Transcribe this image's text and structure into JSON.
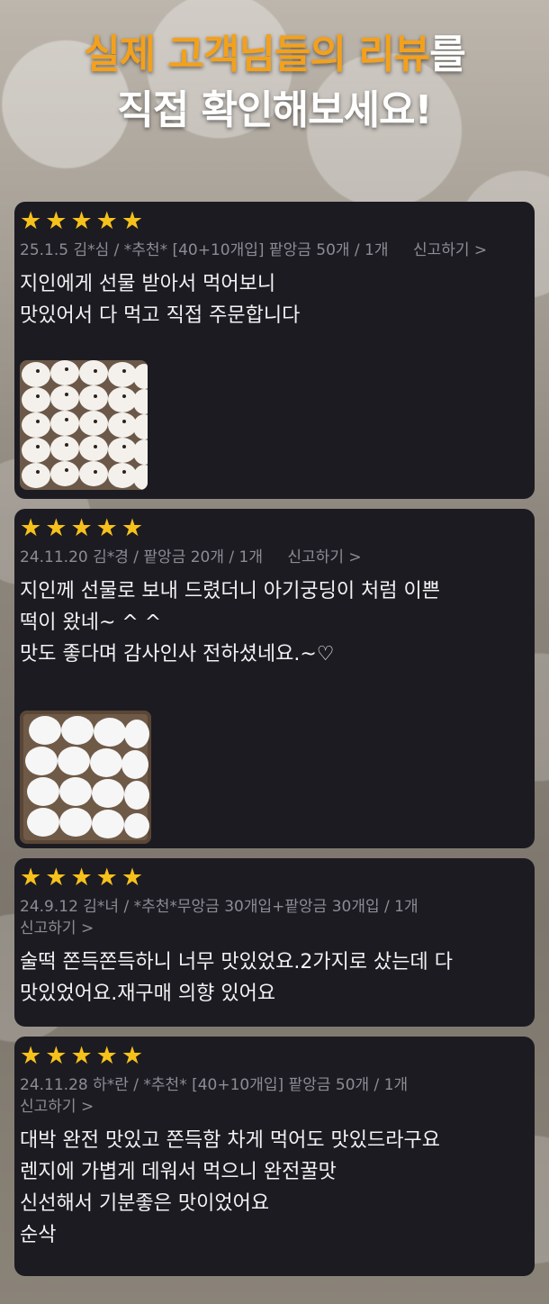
{
  "header": {
    "line1_orange": "실제 고객님들의 리뷰",
    "line1_white": "를",
    "line2": "직접 확인해보세요!"
  },
  "colors": {
    "accent": "#f3a11c",
    "star": "#f7c11b",
    "card_bg": "#1c1b22"
  },
  "reviews": [
    {
      "rating": 5,
      "meta": "25.1.5 김*심 / *추천* [40+10개입] 팥앙금 50개 / 1개",
      "report": "신고하기 >",
      "text_lines": [
        "지인에게 선물 받아서 먹어보니",
        "맛있어서 다 먹고 직접 주문합니다"
      ],
      "photo_icon": "rice-cake-photo"
    },
    {
      "rating": 5,
      "meta": "24.11.20 김*경 / 팥앙금 20개 / 1개",
      "report": "신고하기 >",
      "text_lines": [
        "지인께 선물로 보내 드렸더니 아기궁딩이 처럼 이쁜",
        "떡이 왔네~ ^ ^",
        "맛도 좋다며 감사인사 전하셨네요.~♡"
      ],
      "photo_icon": "rice-cake-photo"
    },
    {
      "rating": 5,
      "meta": "24.9.12 김*녀 / *추천*무앙금 30개입+팥앙금 30개입 / 1개",
      "report": "신고하기 >",
      "text_lines": [
        "술떡 쫀득쫀득하니 너무 맛있었요.2가지로 샀는데 다",
        "맛있었어요.재구매 의향 있어요"
      ]
    },
    {
      "rating": 5,
      "meta": "24.11.28 하*란 / *추천* [40+10개입] 팥앙금 50개 / 1개",
      "report": "신고하기 >",
      "text_lines": [
        "대박 완전 맛있고 쫀득함 차게 먹어도 맛있드라구요",
        "렌지에 가볍게 데워서 먹으니 완전꿀맛",
        "신선해서 기분좋은 맛이었어요",
        "순삭"
      ]
    }
  ]
}
